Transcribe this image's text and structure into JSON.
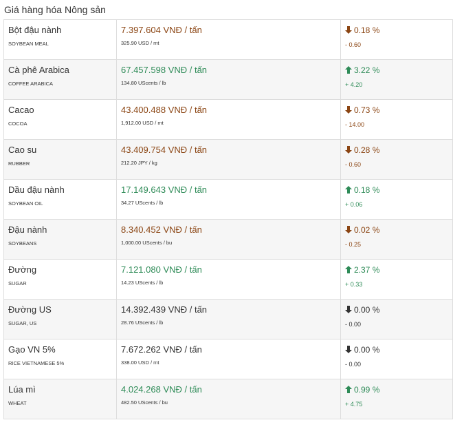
{
  "page": {
    "title": "Giá hàng hóa Nông sản"
  },
  "colors": {
    "up": "#2e8b57",
    "down": "#8b4513",
    "flat": "#333333",
    "border": "#dddddd",
    "row_alt": "#f6f6f6"
  },
  "rows": [
    {
      "name": "Bột đậu nành",
      "code": "SOYBEAN MEAL",
      "price_vnd": "7.397.604 VNĐ / tấn",
      "price_intl": "325.90 USD / mt",
      "direction": "down",
      "arrow": "arrow-down-icon",
      "change_pct": "0.18 %",
      "change_abs": "- 0.60"
    },
    {
      "name": "Cà phê Arabica",
      "code": "COFFEE ARABICA",
      "price_vnd": "67.457.598 VNĐ / tấn",
      "price_intl": "134.80 UScents / lb",
      "direction": "up",
      "arrow": "arrow-up-icon",
      "change_pct": "3.22 %",
      "change_abs": "+ 4.20"
    },
    {
      "name": "Cacao",
      "code": "COCOA",
      "price_vnd": "43.400.488 VNĐ / tấn",
      "price_intl": "1,912.00 USD / mt",
      "direction": "down",
      "arrow": "arrow-down-icon",
      "change_pct": "0.73 %",
      "change_abs": "- 14.00"
    },
    {
      "name": "Cao su",
      "code": "RUBBER",
      "price_vnd": "43.409.754 VNĐ / tấn",
      "price_intl": "212.20 JPY / kg",
      "direction": "down",
      "arrow": "arrow-down-icon",
      "change_pct": "0.28 %",
      "change_abs": "- 0.60"
    },
    {
      "name": "Dầu đậu nành",
      "code": "SOYBEAN OIL",
      "price_vnd": "17.149.643 VNĐ / tấn",
      "price_intl": "34.27 UScents / lb",
      "direction": "up",
      "arrow": "arrow-up-icon",
      "change_pct": "0.18 %",
      "change_abs": "+ 0.06"
    },
    {
      "name": "Đậu nành",
      "code": "SOYBEANS",
      "price_vnd": "8.340.452 VNĐ / tấn",
      "price_intl": "1,000.00 UScents / bu",
      "direction": "down",
      "arrow": "arrow-down-icon",
      "change_pct": "0.02 %",
      "change_abs": "- 0.25"
    },
    {
      "name": "Đường",
      "code": "SUGAR",
      "price_vnd": "7.121.080 VNĐ / tấn",
      "price_intl": "14.23 UScents / lb",
      "direction": "up",
      "arrow": "arrow-up-icon",
      "change_pct": "2.37 %",
      "change_abs": "+ 0.33"
    },
    {
      "name": "Đường US",
      "code": "SUGAR, US",
      "price_vnd": "14.392.439 VNĐ / tấn",
      "price_intl": "28.76 UScents / lb",
      "direction": "flat",
      "arrow": "arrow-down-icon",
      "change_pct": "0.00 %",
      "change_abs": "- 0.00"
    },
    {
      "name": "Gạo VN 5%",
      "code": "RICE VIETNAMESE 5%",
      "price_vnd": "7.672.262 VNĐ / tấn",
      "price_intl": "338.00 USD / mt",
      "direction": "flat",
      "arrow": "arrow-down-icon",
      "change_pct": "0.00 %",
      "change_abs": "- 0.00"
    },
    {
      "name": "Lúa mì",
      "code": "WHEAT",
      "price_vnd": "4.024.268 VNĐ / tấn",
      "price_intl": "482.50 UScents / bu",
      "direction": "up",
      "arrow": "arrow-up-icon",
      "change_pct": "0.99 %",
      "change_abs": "+ 4.75"
    }
  ]
}
